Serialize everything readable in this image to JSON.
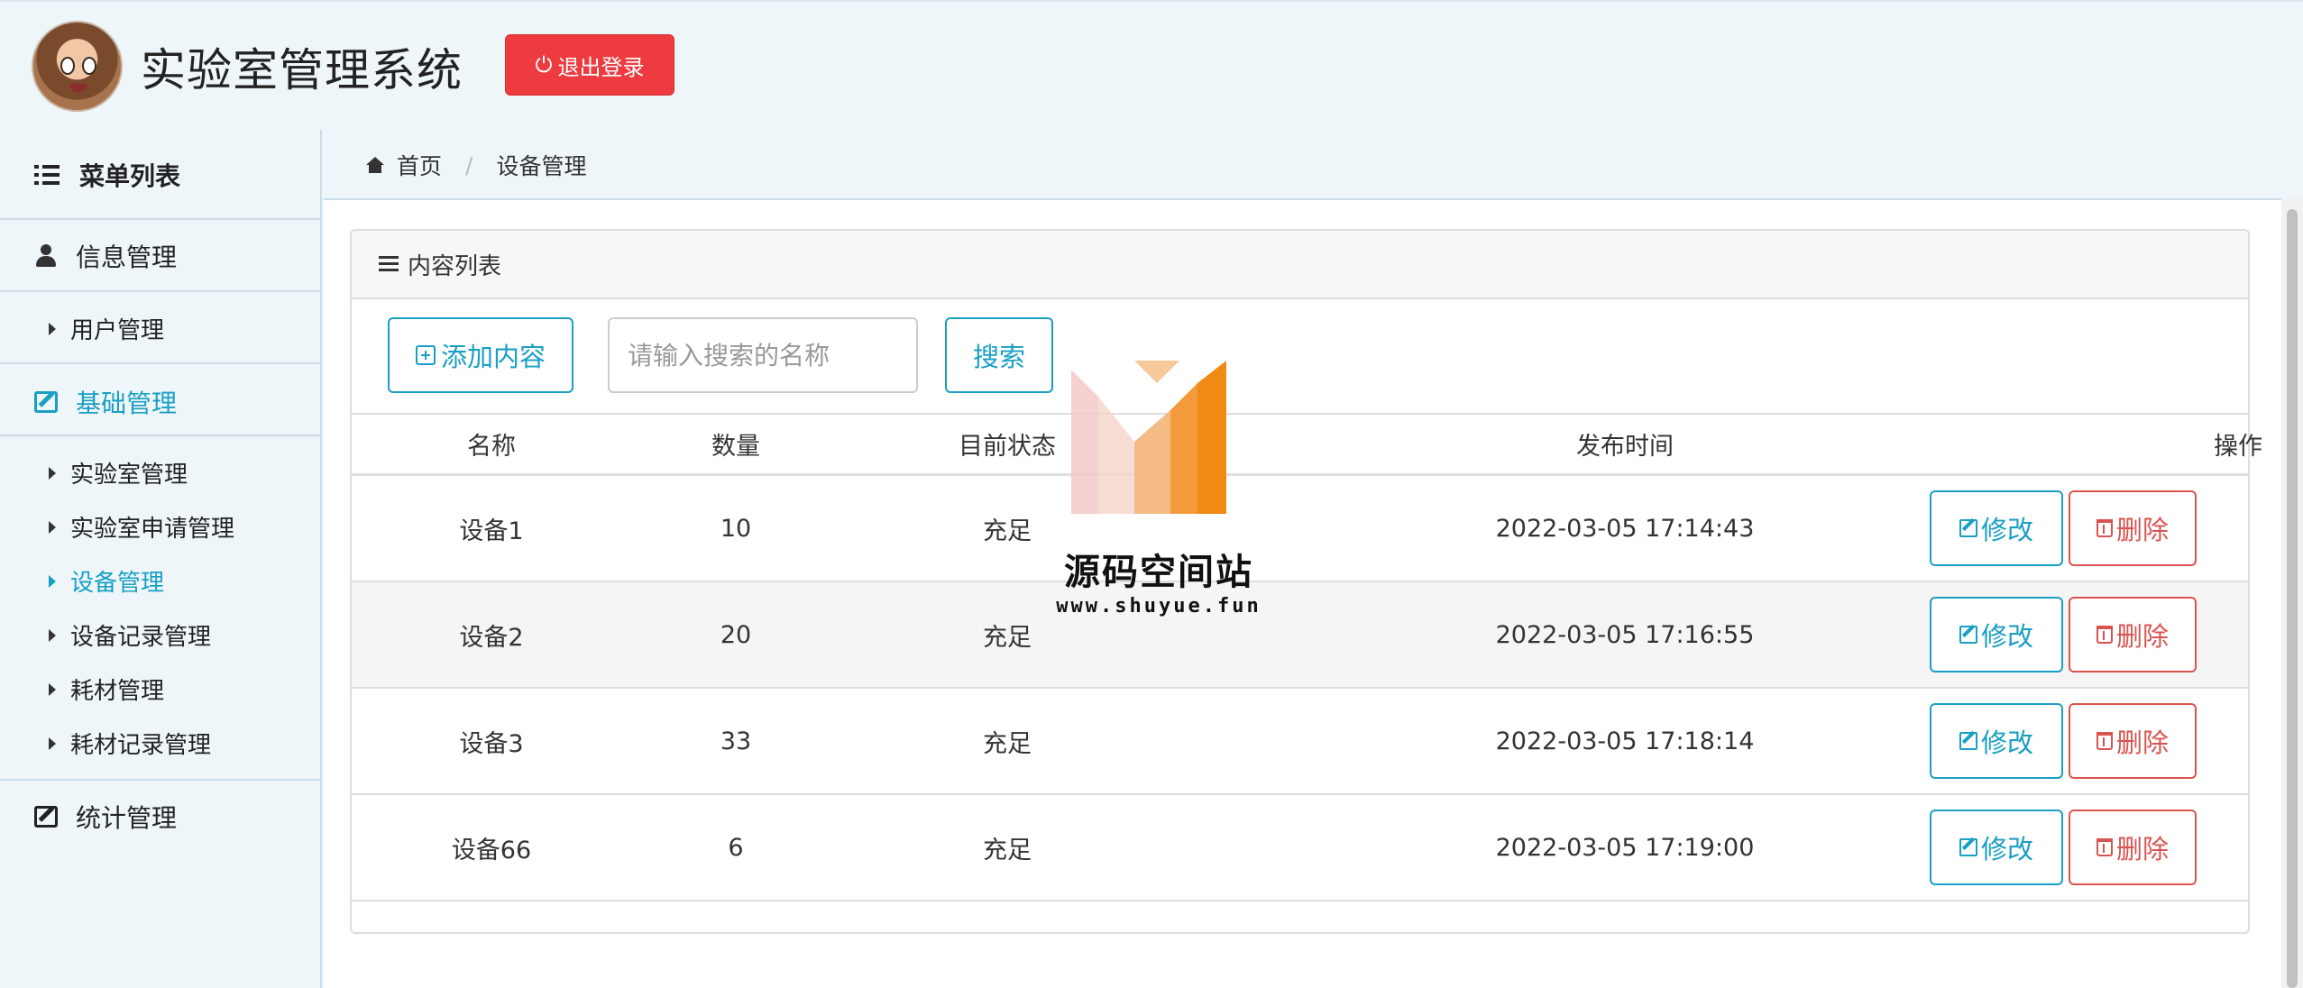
{
  "header": {
    "app_title": "实验室管理系统",
    "logout_label": "退出登录"
  },
  "sidebar": {
    "menu_title": "菜单列表",
    "sections": [
      {
        "label": "信息管理",
        "icon": "user-icon",
        "items": [
          {
            "label": "用户管理"
          }
        ]
      },
      {
        "label": "基础管理",
        "icon": "edit-icon",
        "active": true,
        "items": [
          {
            "label": "实验室管理"
          },
          {
            "label": "实验室申请管理"
          },
          {
            "label": "设备管理",
            "active": true
          },
          {
            "label": "设备记录管理"
          },
          {
            "label": "耗材管理"
          },
          {
            "label": "耗材记录管理"
          }
        ]
      },
      {
        "label": "统计管理",
        "icon": "edit-icon",
        "items": []
      }
    ]
  },
  "breadcrumb": {
    "home": "首页",
    "current": "设备管理"
  },
  "panel": {
    "title": "内容列表",
    "add_label": "添加内容",
    "search_placeholder": "请输入搜索的名称",
    "search_label": "搜索"
  },
  "table": {
    "headers": [
      "名称",
      "数量",
      "目前状态",
      "发布时间",
      "操作"
    ],
    "rows": [
      {
        "name": "设备1",
        "qty": "10",
        "status": "充足",
        "time": "2022-03-05 17:14:43"
      },
      {
        "name": "设备2",
        "qty": "20",
        "status": "充足",
        "time": "2022-03-05 17:16:55"
      },
      {
        "name": "设备3",
        "qty": "33",
        "status": "充足",
        "time": "2022-03-05 17:18:14"
      },
      {
        "name": "设备66",
        "qty": "6",
        "status": "充足",
        "time": "2022-03-05 17:19:00"
      }
    ],
    "edit_label": "修改",
    "delete_label": "删除"
  },
  "watermark": {
    "title": "源码空间站",
    "url": "www.shuyue.fun"
  },
  "colors": {
    "accent": "#1a9fc4",
    "danger": "#ed3b3f",
    "background": "#eef6fa"
  }
}
